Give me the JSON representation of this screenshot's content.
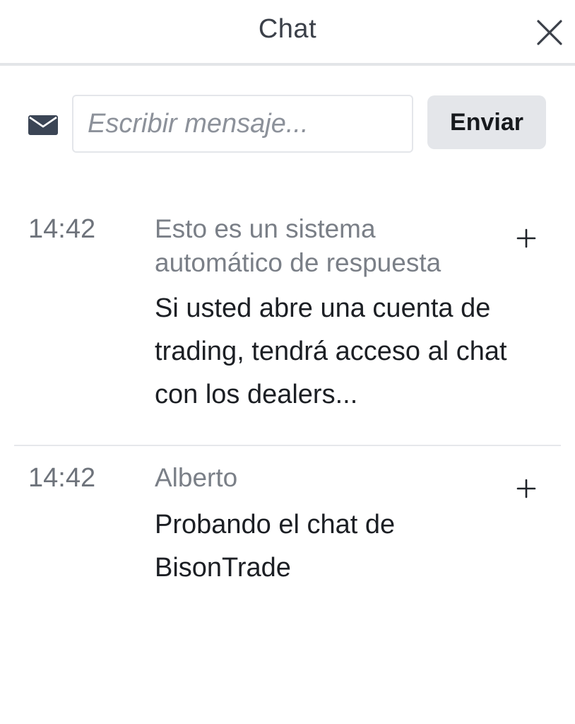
{
  "header": {
    "title": "Chat"
  },
  "composer": {
    "placeholder": "Escribir mensaje...",
    "value": "",
    "send_label": "Enviar"
  },
  "messages": [
    {
      "time": "14:42",
      "author": "Esto es un sistema automático de respuesta",
      "text": "Si usted abre una cuenta de trading, tendrá acceso al chat con los dealers..."
    },
    {
      "time": "14:42",
      "author": "Alberto",
      "text": "Probando el chat de BisonTrade"
    }
  ],
  "icons": {
    "close": "close-icon",
    "mail": "mail-icon",
    "expand": "plus-icon"
  },
  "colors": {
    "header_divider": "#e3e5e8",
    "send_button_bg": "#e4e6ea",
    "muted_text": "#7a7f87",
    "icon": "#3b4555"
  }
}
